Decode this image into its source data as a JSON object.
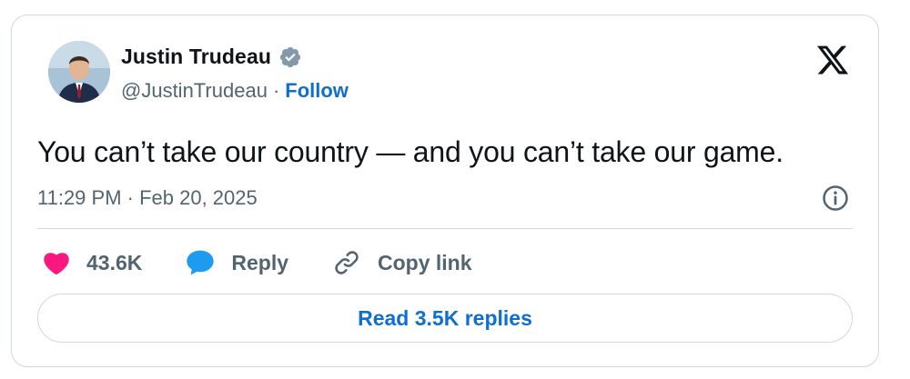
{
  "author": {
    "name": "Justin Trudeau",
    "handle": "@JustinTrudeau",
    "separator": "·",
    "follow_label": "Follow",
    "verified_icon": "verified-badge-icon"
  },
  "tweet": {
    "text": "You can’t take our country — and you can’t take our game.",
    "timestamp": "11:29 PM · Feb 20, 2025"
  },
  "actions": {
    "likes": "43.6K",
    "reply_label": "Reply",
    "copy_link_label": "Copy link"
  },
  "read_replies_label": "Read 3.5K replies",
  "colors": {
    "accent": "#0f6fcf",
    "heart": "#f91880",
    "reply_bubble": "#1d9bf0",
    "muted": "#536471",
    "text": "#0f1419",
    "border": "#cfd9de"
  },
  "icons": [
    "x-logo-icon",
    "info-icon",
    "heart-icon",
    "reply-bubble-icon",
    "link-icon"
  ]
}
